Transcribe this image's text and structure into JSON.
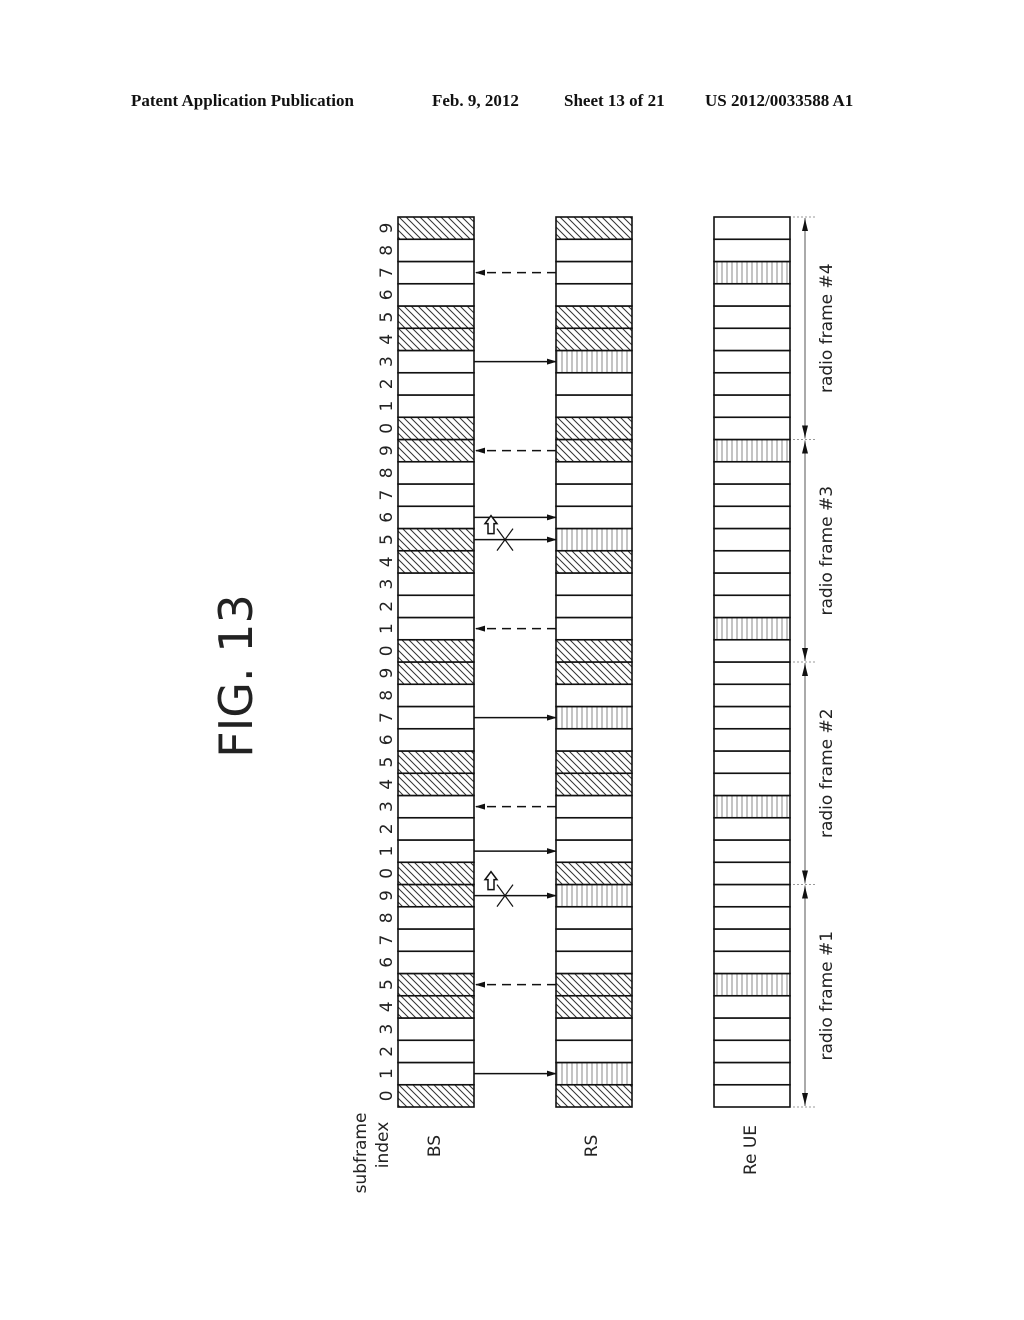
{
  "header": {
    "left": "Patent Application Publication",
    "date": "Feb. 9, 2012",
    "sheet": "Sheet 13 of 21",
    "pub_number": "US 2012/0033588 A1"
  },
  "figure_title": "FIG. 13",
  "labels": {
    "subframe_index_line1": "subframe",
    "subframe_index_line2": "index",
    "bs": "BS",
    "rs": "RS",
    "re_ue": "Re UE"
  },
  "radio_frames": [
    "radio frame #1",
    "radio frame #2",
    "radio frame #3",
    "radio frame #4"
  ],
  "subframes_per_frame": 10,
  "subframe_index_labels": [
    "0",
    "1",
    "2",
    "3",
    "4",
    "5",
    "6",
    "7",
    "8",
    "9"
  ],
  "legend_patterns": {
    "D": "diagonal hatch",
    "V": "vertical hatch",
    "N": "blank"
  },
  "columns": {
    "bs": [
      "DNNNDDNNND",
      "DNNNDDNNND",
      "DNNNDDNNND",
      "DNNNDDNNND"
    ],
    "rs": [
      "DVNNDDNNNV",
      "DNNNDDNVND",
      "DNNNDVNNND",
      "DNNVDDNNND"
    ],
    "re_ue": [
      "NNNNNVNNNN",
      "NNNVNNNNNN",
      "NVNNNNNNNV",
      "NNNNNNNVNN"
    ]
  },
  "arrows": [
    {
      "frame": 1,
      "subframe": 1,
      "dir": "bs_to_rs",
      "style": "solid",
      "blocked": false
    },
    {
      "frame": 1,
      "subframe": 5,
      "dir": "rs_to_bs",
      "style": "dashed",
      "blocked": false
    },
    {
      "frame": 1,
      "subframe": 9,
      "dir": "bs_to_rs",
      "style": "solid",
      "blocked": true
    },
    {
      "frame": 2,
      "subframe": 1,
      "dir": "bs_to_rs",
      "style": "solid",
      "blocked": false
    },
    {
      "frame": 2,
      "subframe": 3,
      "dir": "rs_to_bs",
      "style": "dashed",
      "blocked": false
    },
    {
      "frame": 2,
      "subframe": 7,
      "dir": "bs_to_rs",
      "style": "solid",
      "blocked": false
    },
    {
      "frame": 3,
      "subframe": 1,
      "dir": "rs_to_bs",
      "style": "dashed",
      "blocked": false
    },
    {
      "frame": 3,
      "subframe": 5,
      "dir": "bs_to_rs",
      "style": "solid",
      "blocked": true
    },
    {
      "frame": 3,
      "subframe": 6,
      "dir": "bs_to_rs",
      "style": "solid",
      "blocked": false
    },
    {
      "frame": 3,
      "subframe": 9,
      "dir": "rs_to_bs",
      "style": "dashed",
      "blocked": false
    },
    {
      "frame": 4,
      "subframe": 3,
      "dir": "bs_to_rs",
      "style": "solid",
      "blocked": false
    },
    {
      "frame": 4,
      "subframe": 7,
      "dir": "rs_to_bs",
      "style": "dashed",
      "blocked": false
    }
  ],
  "shift_arrows": [
    {
      "from_frame": 1,
      "from_subframe": 9,
      "to_frame": 2,
      "to_subframe": 0
    },
    {
      "from_frame": 3,
      "from_subframe": 5,
      "to_frame": 3,
      "to_subframe": 6
    }
  ]
}
